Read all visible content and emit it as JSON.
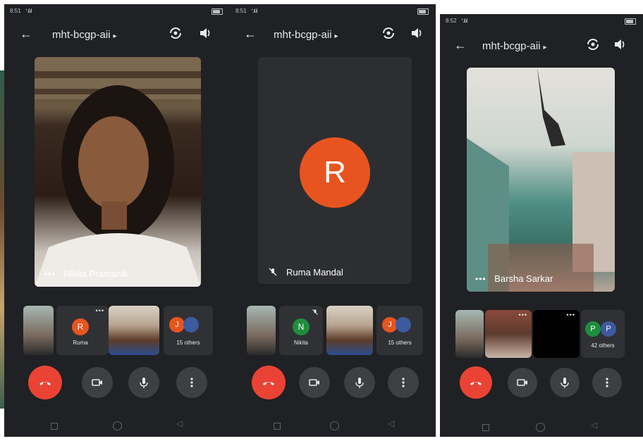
{
  "meeting_name": "mht-bcgp-aii",
  "icons": {
    "back": "arrow-back-icon",
    "switch_camera": "switch-camera-icon",
    "speaker": "speaker-icon",
    "more": "more-vert-icon",
    "end_call": "call-end-icon",
    "camera": "videocam-icon",
    "mic": "mic-icon",
    "mic_off": "mic-off-icon"
  },
  "colors": {
    "end_call": "#ea4335",
    "avatar_orange": "#e8541f",
    "avatar_green": "#1e8e3e",
    "background": "#202124"
  },
  "screens": [
    {
      "status_time": "8:51",
      "main_tile": {
        "name": "Nikita Pramanik",
        "type": "video"
      },
      "thumbnails": [
        {
          "type": "video"
        },
        {
          "type": "avatar",
          "initial": "R",
          "name": "Ruma"
        },
        {
          "type": "video"
        },
        {
          "type": "group",
          "initial": "J",
          "count_label": "15 others"
        }
      ]
    },
    {
      "status_time": "8:51",
      "main_tile": {
        "name": "Ruma Mandal",
        "type": "avatar",
        "initial": "R",
        "muted": true
      },
      "thumbnails": [
        {
          "type": "video"
        },
        {
          "type": "avatar",
          "initial": "N",
          "name": "Nikita"
        },
        {
          "type": "video"
        },
        {
          "type": "group",
          "initial": "J",
          "count_label": "15 others"
        }
      ]
    },
    {
      "status_time": "8:52",
      "main_tile": {
        "name": "Barsha Sarkar",
        "type": "video"
      },
      "thumbnails": [
        {
          "type": "video"
        },
        {
          "type": "video"
        },
        {
          "type": "video"
        },
        {
          "type": "group",
          "initial": "P",
          "initial2": "P",
          "count_label": "42 others"
        }
      ]
    }
  ]
}
